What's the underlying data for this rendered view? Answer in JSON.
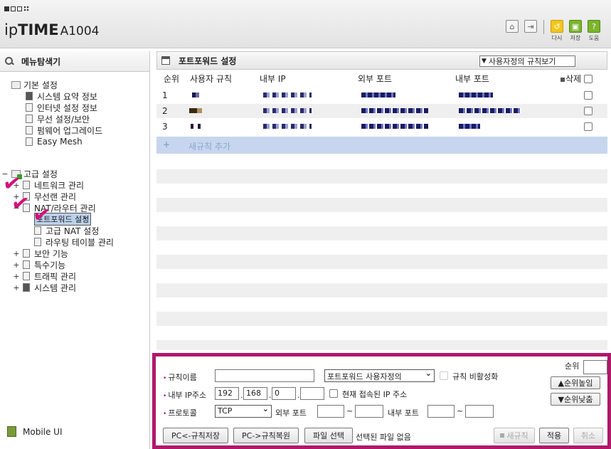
{
  "header": {
    "logo_ip": "ip",
    "logo_time": "TIME",
    "logo_model": "A1004",
    "buttons": [
      {
        "name": "home",
        "label": ""
      },
      {
        "name": "logout",
        "label": ""
      },
      {
        "name": "reload",
        "label": "다시"
      },
      {
        "name": "save",
        "label": "저장"
      },
      {
        "name": "help",
        "label": "도움"
      }
    ]
  },
  "sidebar": {
    "title": "메뉴탐색기",
    "basic": {
      "label": "기본 설정",
      "items": [
        "시스템 요약 정보",
        "인터넷 설정 정보",
        "무선 설정/보안",
        "펌웨어 업그레이드",
        "Easy Mesh"
      ]
    },
    "advanced": {
      "label": "고급 설정",
      "items": {
        "network": "네트워크 관리",
        "wireless": "무선랜 관리",
        "nat": "NAT/라우터 관리",
        "nat_children": [
          "포트포워드 설정",
          "고급 NAT 설정",
          "라우팅 테이블 관리"
        ],
        "security": "보안 기능",
        "special": "특수기능",
        "traffic": "트래픽 관리",
        "system": "시스템 관리"
      }
    },
    "mobile_ui": "Mobile UI"
  },
  "main": {
    "title": "포트포워드 설정",
    "view_select": "사용자정의 규칙보기",
    "columns": [
      "순위",
      "사용자 규칙",
      "내부 IP",
      "외부 포트",
      "내부 포트",
      "삭제"
    ],
    "rows": [
      {
        "rank": "1"
      },
      {
        "rank": "2"
      },
      {
        "rank": "3"
      }
    ],
    "add_rule": "새규칙 추가"
  },
  "form": {
    "rule_name_label": "규칙이름",
    "rule_name_value": "",
    "type_select": "포트포워드 사용자정의",
    "disable_rule_label": "규칙 비활성화",
    "internal_ip_label": "내부 IP주소",
    "ip": [
      "192",
      "168",
      "0",
      ""
    ],
    "current_ip_label": "현재 접속된 IP 주소",
    "protocol_label": "프로토콜",
    "protocol_value": "TCP",
    "external_port_label": "외부 포트",
    "internal_port_label": "내부 포트",
    "rank_label": "순위",
    "rank_up": "▲순위높임",
    "rank_down": "▼순위낮춤",
    "save_rules": "PC<-규칙저장",
    "restore_rules": "PC->규칙복원",
    "choose_file": "파일 선택",
    "no_file": "선택된 파일 없음",
    "new_rule": "새규칙",
    "apply": "적용",
    "cancel": "취소"
  }
}
